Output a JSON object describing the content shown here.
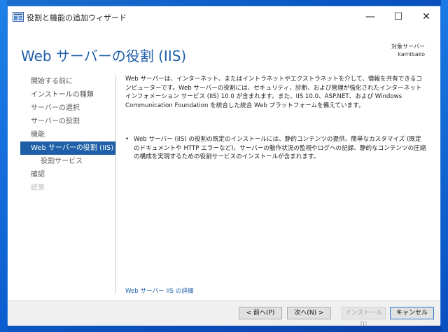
{
  "window": {
    "title": "役割と機能の追加ウィザード",
    "minimize": "—",
    "maximize": "☐",
    "close": "✕"
  },
  "header": {
    "title": "Web サーバーの役割 (IIS)",
    "target_label": "対象サーバー",
    "target_name": "kamibako"
  },
  "nav": {
    "items": [
      {
        "label": "開始する前に",
        "state": "normal"
      },
      {
        "label": "インストールの種類",
        "state": "normal"
      },
      {
        "label": "サーバーの選択",
        "state": "normal"
      },
      {
        "label": "サーバーの役割",
        "state": "normal"
      },
      {
        "label": "機能",
        "state": "normal"
      },
      {
        "label": "Web サーバーの役割 (IIS)",
        "state": "selected"
      },
      {
        "label": "役割サービス",
        "state": "sub"
      },
      {
        "label": "確認",
        "state": "normal"
      },
      {
        "label": "結果",
        "state": "disabled"
      }
    ]
  },
  "main": {
    "description": "Web サーバーは、インターネット、またはイントラネットやエクストラネットを介して、情報を共有できるコンピューターです。Web サーバーの役割には、セキュリティ、診断、および管理が強化されたインターネット インフォメーション サービス (IIS) 10.0 が含まれます。また、IIS 10.0、ASP.NET、および Windows Communication Foundation を統合した統合 Web プラットフォームを備えています。",
    "bullet": "Web サーバー (IIS) の役割の既定のインストールには、静的コンテンツの提供、簡単なカスタマイズ (既定のドキュメントや HTTP エラーなど)、サーバーの動作状況の監視やログへの記録、静的なコンテンツの圧縮の構成を実現するための役割サービスのインストールが含まれます。",
    "link": "Web サーバー IIS の詳細"
  },
  "footer": {
    "prev": "< 前へ(P)",
    "next": "次へ(N) >",
    "install": "インストール(I)",
    "cancel": "キャンセル"
  },
  "colors": {
    "accent": "#1e5fa7",
    "title_text": "#1e5fa7"
  }
}
